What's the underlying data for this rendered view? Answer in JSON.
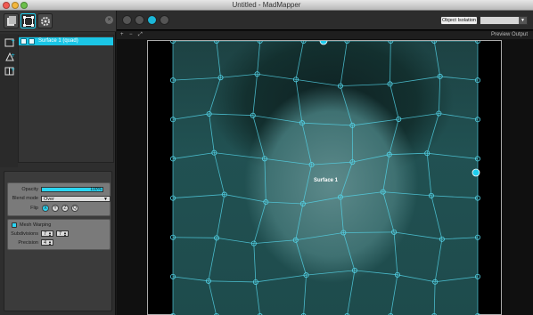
{
  "window": {
    "title": "Untitled - MadMapper"
  },
  "left_panel": {
    "toolbar": {
      "buttons": [
        "media-icon",
        "surfaces-icon",
        "settings-icon"
      ]
    },
    "side_tools": [
      "add-quad-icon",
      "add-triangle-icon",
      "add-mesh-icon"
    ],
    "surfaces": [
      {
        "name": "Surface 1 (quad)"
      }
    ]
  },
  "properties": {
    "opacity_label": "Opacity",
    "opacity_value": "100%",
    "opacity_fraction": 1.0,
    "blend_label": "Blend mode",
    "blend_value": "Over",
    "flip_label": "Flip",
    "flip_buttons": [
      "X",
      "Y",
      "Z",
      "Q"
    ],
    "mesh_warping_label": "Mesh Warping",
    "subdivisions_label": "Subdivisions",
    "subdivisions_x": "7",
    "subdivisions_y": "7",
    "precision_label": "Precision",
    "precision_value": "4"
  },
  "main": {
    "toolbar": {
      "object_isolation_label": "Object Isolation",
      "object_isolation_value": ""
    },
    "subbar": {
      "plus": "+",
      "minus": "−",
      "fit": "⤢",
      "preview_label": "Preview Output"
    },
    "surface_label": "Surface 1"
  },
  "colors": {
    "accent": "#1fcdee",
    "mesh": "#54d4e8",
    "background": "#101010"
  }
}
